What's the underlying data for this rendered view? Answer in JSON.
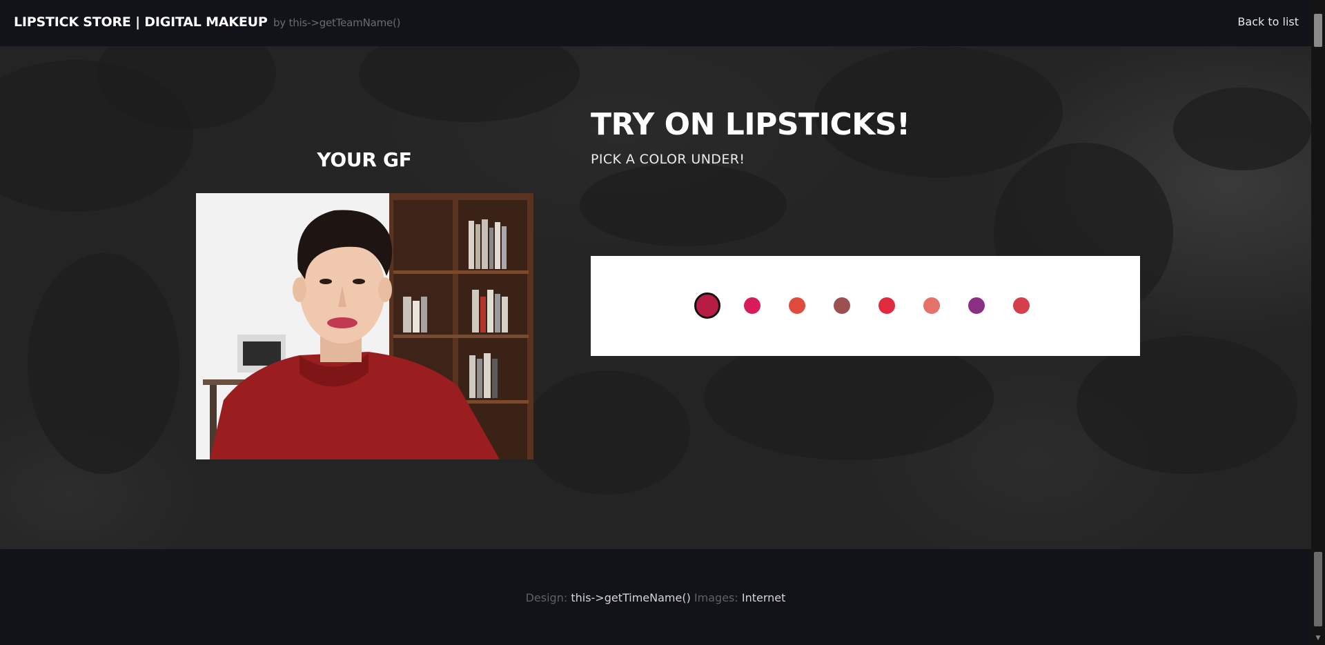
{
  "header": {
    "brand": "LIPSTICK STORE | DIGITAL MAKEUP",
    "brand_by": "by this->getTeamName()",
    "back_link": "Back to list"
  },
  "left_panel": {
    "title": "YOUR GF"
  },
  "right_panel": {
    "title": "TRY ON LIPSTICKS!",
    "subtitle": "PICK A COLOR UNDER!"
  },
  "swatches": [
    {
      "color": "#b71c44",
      "selected": true
    },
    {
      "color": "#d81b5a",
      "selected": false
    },
    {
      "color": "#e04a3a",
      "selected": false
    },
    {
      "color": "#9c5050",
      "selected": false
    },
    {
      "color": "#e02a3e",
      "selected": false
    },
    {
      "color": "#e4716a",
      "selected": false
    },
    {
      "color": "#8b2f85",
      "selected": false
    },
    {
      "color": "#d43e4d",
      "selected": false
    }
  ],
  "footer": {
    "design_label": "Design:",
    "design_value": "this->getTimeName()",
    "images_label": "Images:",
    "images_value": "Internet"
  }
}
